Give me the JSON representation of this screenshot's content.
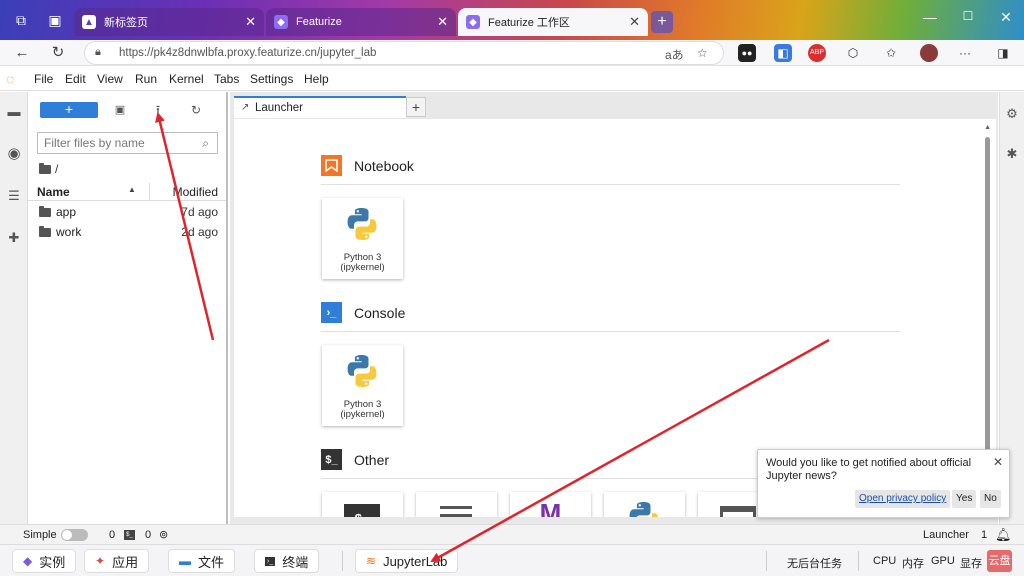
{
  "browser": {
    "tabs": [
      {
        "title": "新标签页",
        "active": false
      },
      {
        "title": "Featurize",
        "active": false
      },
      {
        "title": "Featurize 工作区",
        "active": true
      }
    ],
    "url": "https://pk4z8dnwlbfa.proxy.featurize.cn/jupyter_lab",
    "new_tab_icon": "plus-icon"
  },
  "menubar": {
    "items": [
      "File",
      "Edit",
      "View",
      "Run",
      "Kernel",
      "Tabs",
      "Settings",
      "Help"
    ]
  },
  "filebrowser": {
    "new_label": "+",
    "filter_placeholder": "Filter files by name",
    "breadcrumb": "/",
    "header_name": "Name",
    "header_modified": "Modified",
    "files": [
      {
        "name": "app",
        "modified": "7d ago"
      },
      {
        "name": "work",
        "modified": "2d ago"
      }
    ]
  },
  "dock": {
    "tab_label": "Launcher",
    "add_label": "+"
  },
  "launcher": {
    "sections": [
      {
        "title": "Notebook",
        "icon_color": "#f37626",
        "cards": [
          {
            "caption_1": "Python 3",
            "caption_2": "(ipykernel)"
          }
        ]
      },
      {
        "title": "Console",
        "icon_color": "#2f7ed8",
        "cards": [
          {
            "caption_1": "Python 3",
            "caption_2": "(ipykernel)"
          }
        ]
      },
      {
        "title": "Other",
        "icon_color": "#333333",
        "cards": []
      }
    ]
  },
  "notification": {
    "message": "Would you like to get notified about official Jupyter news?",
    "privacy_label": "Open privacy policy",
    "yes_label": "Yes",
    "no_label": "No"
  },
  "statusbar": {
    "mode_label": "Simple",
    "terminals_count": "0",
    "kernels_count": "0",
    "right_label": "Launcher",
    "right_count": "1"
  },
  "bottombar": {
    "buttons": [
      "实例",
      "应用",
      "文件",
      "终端",
      "JupyterLab"
    ],
    "task_label": "无后台任务",
    "metrics": [
      "CPU",
      "内存",
      "GPU",
      "显存"
    ],
    "disk_label": "云盘"
  },
  "colors": {
    "accent": "#2f7ed8",
    "jupyter_orange": "#f37626",
    "annotation_arrow": "#e0242b"
  }
}
